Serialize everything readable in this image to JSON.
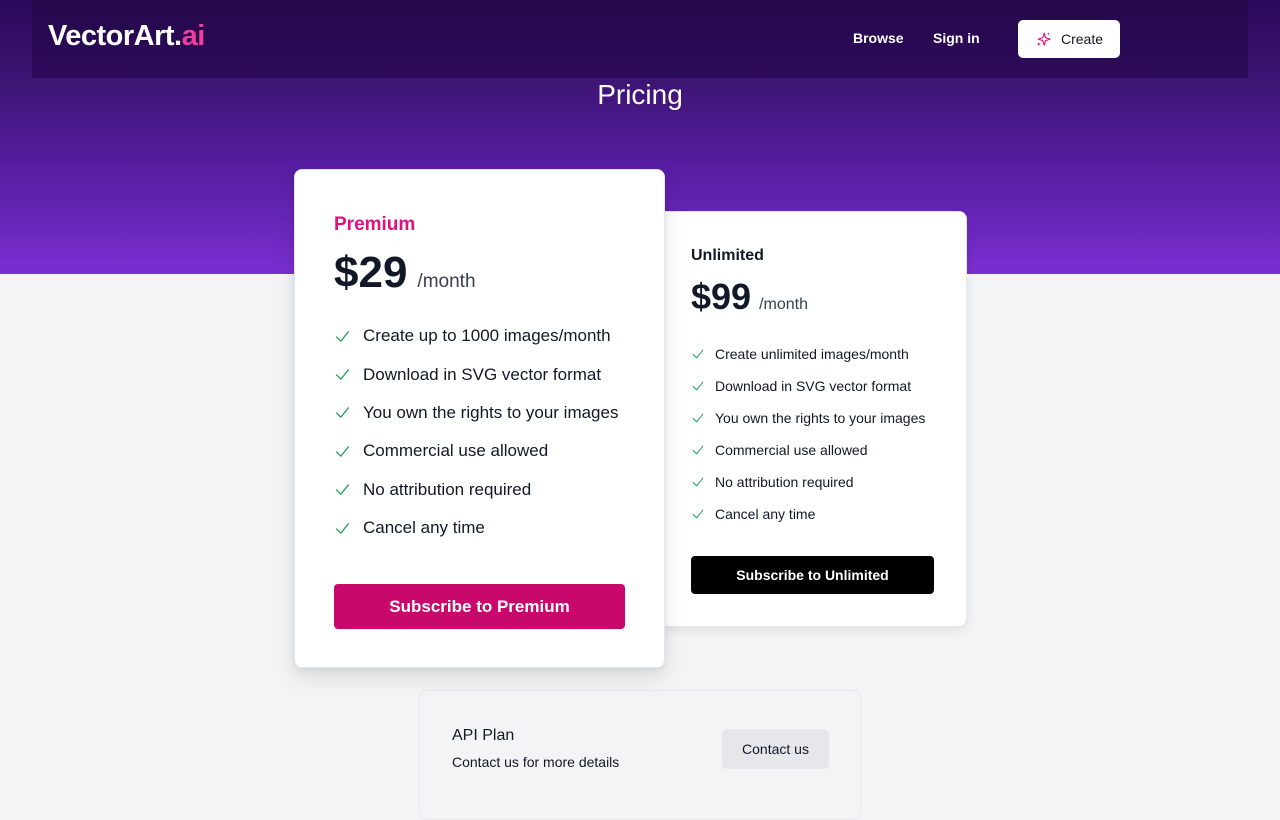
{
  "header": {
    "logo_main": "VectorArt.",
    "logo_accent": "ai",
    "nav": {
      "browse": "Browse",
      "sign_in": "Sign in",
      "create": "Create"
    }
  },
  "page": {
    "title": "Pricing"
  },
  "plans": {
    "premium": {
      "name": "Premium",
      "price": "$29",
      "period": "/month",
      "features": [
        "Create up to 1000 images/month",
        "Download in SVG vector format",
        "You own the rights to your images",
        "Commercial use allowed",
        "No attribution required",
        "Cancel any time"
      ],
      "cta": "Subscribe to Premium"
    },
    "unlimited": {
      "name": "Unlimited",
      "price": "$99",
      "period": "/month",
      "features": [
        "Create unlimited images/month",
        "Download in SVG vector format",
        "You own the rights to your images",
        "Commercial use allowed",
        "No attribution required",
        "Cancel any time"
      ],
      "cta": "Subscribe to Unlimited"
    },
    "api": {
      "name": "API Plan",
      "description": "Contact us for more details",
      "cta": "Contact us"
    }
  },
  "icons": {
    "create": "sparkle-icon",
    "feature": "check-icon"
  },
  "colors": {
    "brand_pink": "#e0117f",
    "premium_button": "#c8096b",
    "check_green": "#22a05a",
    "hero_top": "#2a0a5a",
    "hero_bottom": "#7a2fd0"
  }
}
